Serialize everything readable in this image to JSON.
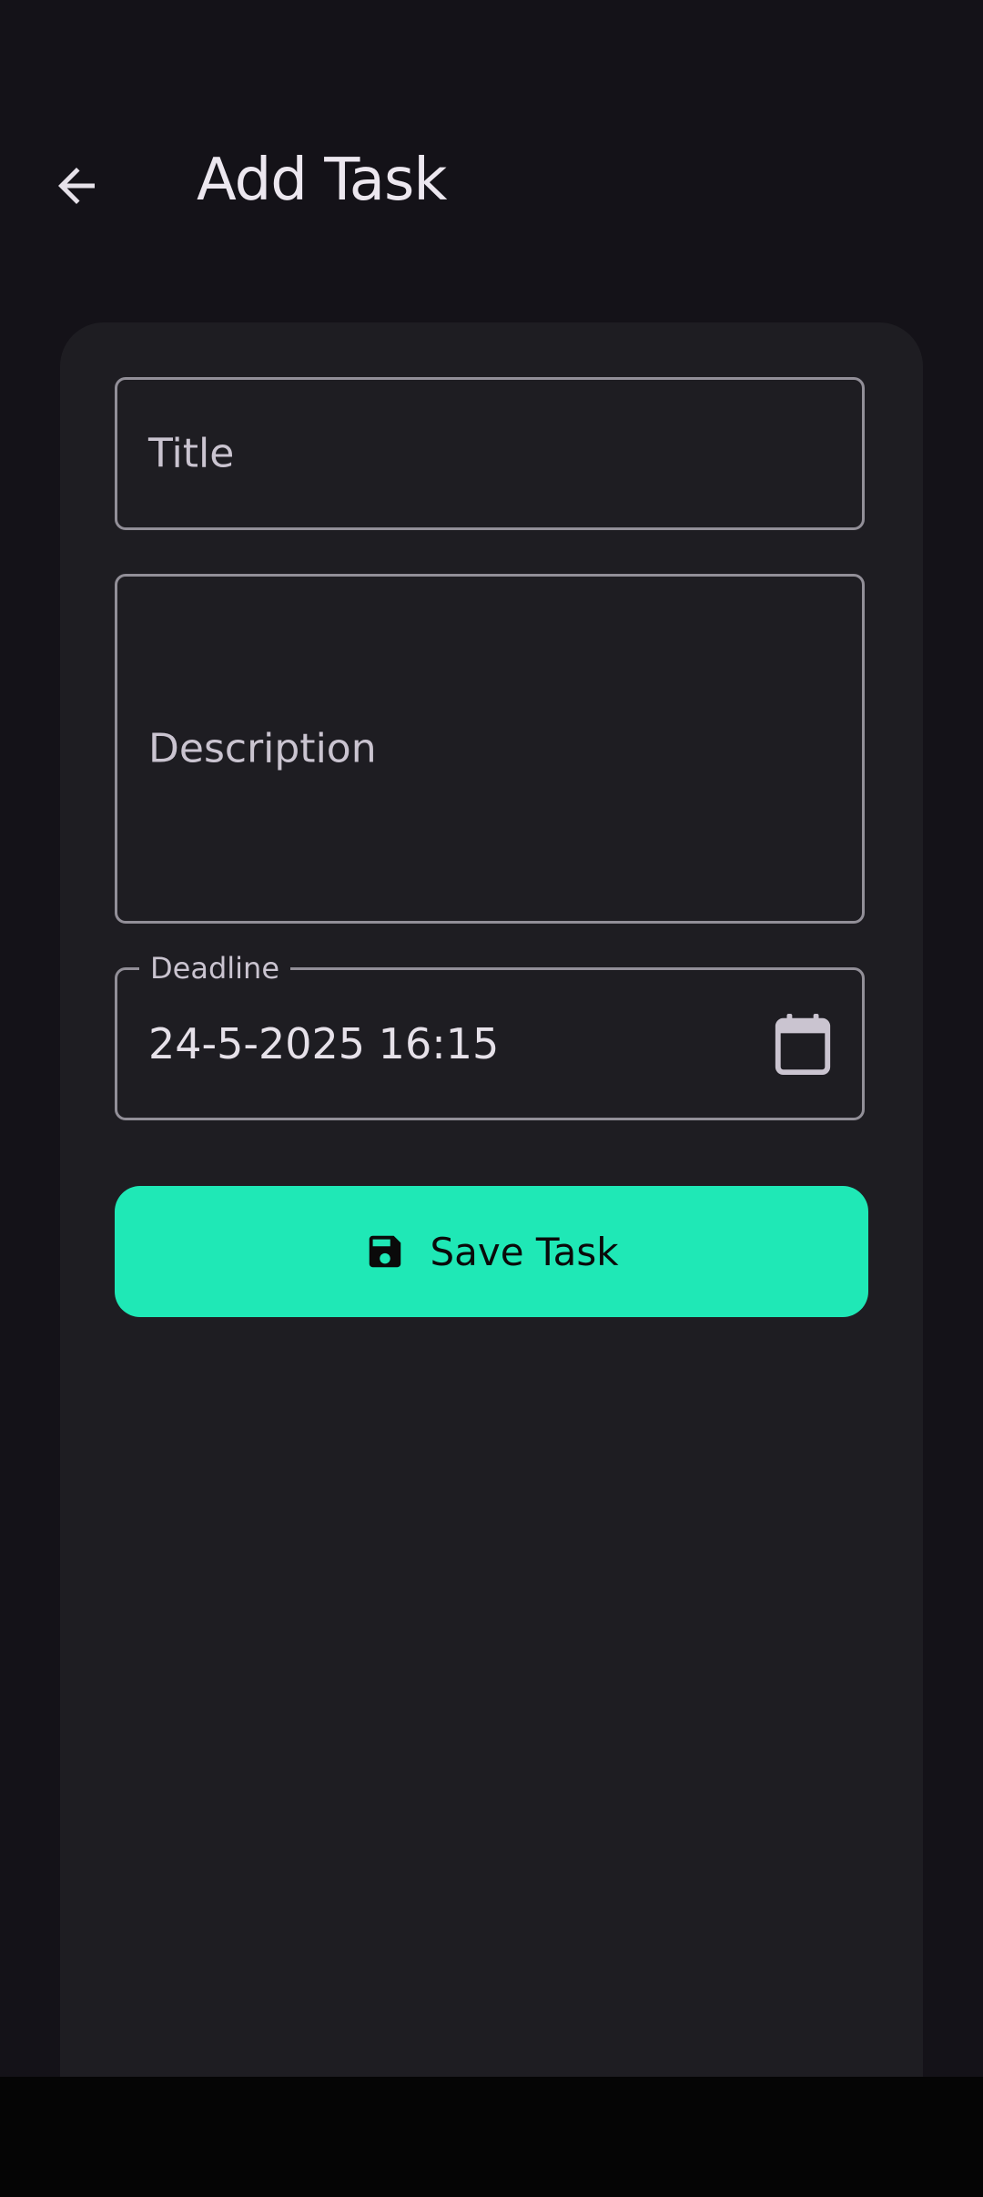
{
  "header": {
    "title": "Add Task",
    "back_icon": "arrow-back-icon"
  },
  "form": {
    "title_placeholder": "Title",
    "description_placeholder": "Description",
    "deadline_label": "Deadline",
    "deadline_value": "24-5-2025 16:15",
    "calendar_icon": "calendar-icon"
  },
  "actions": {
    "save_label": "Save Task",
    "save_icon": "floppy-disk-icon"
  },
  "colors": {
    "background": "#141218",
    "card": "#1e1d22",
    "accent": "#1fe8b6",
    "outline": "#928f98"
  }
}
